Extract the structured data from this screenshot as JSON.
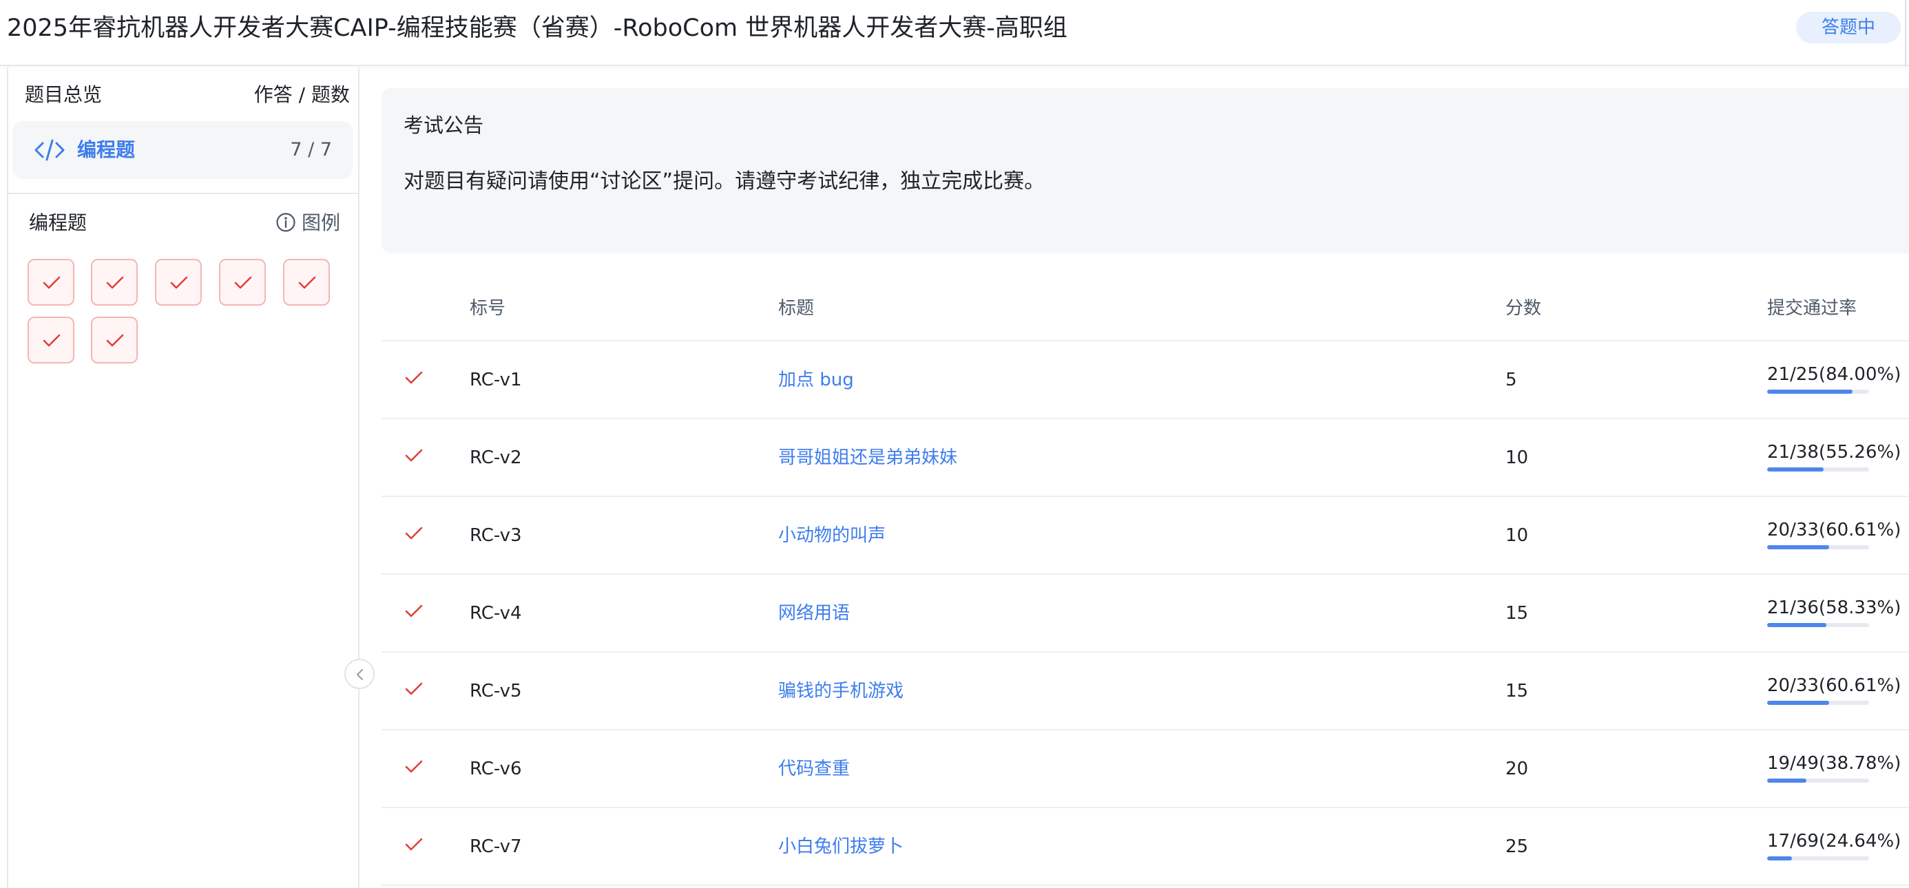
{
  "header": {
    "title": "2025年睿抗机器人开发者大赛CAIP-编程技能赛（省赛）-RoboCom 世界机器人开发者大赛-高职组",
    "status": "答题中"
  },
  "sidebar": {
    "overview_label": "题目总览",
    "answer_count_label": "作答 / 题数",
    "section": {
      "label": "编程题",
      "count": "7 / 7",
      "icon": "code-icon"
    },
    "sub_label": "编程题",
    "legend_label": "图例",
    "legend_icon": "info-icon",
    "questions": [
      {
        "status": "answered"
      },
      {
        "status": "answered"
      },
      {
        "status": "answered"
      },
      {
        "status": "answered"
      },
      {
        "status": "answered"
      },
      {
        "status": "answered"
      },
      {
        "status": "answered"
      }
    ]
  },
  "notice": {
    "title": "考试公告",
    "body": "对题目有疑问请使用“讨论区”提问。请遵守考试纪律，独立完成比赛。"
  },
  "table": {
    "headers": {
      "id": "标号",
      "title": "标题",
      "score": "分数",
      "rate": "提交通过率"
    },
    "rows": [
      {
        "id": "RC-v1",
        "title": "加点 bug",
        "score": "5",
        "rate": "21/25(84.00%)",
        "rate_value": 0.84
      },
      {
        "id": "RC-v2",
        "title": "哥哥姐姐还是弟弟妹妹",
        "score": "10",
        "rate": "21/38(55.26%)",
        "rate_value": 0.5526
      },
      {
        "id": "RC-v3",
        "title": "小动物的叫声",
        "score": "10",
        "rate": "20/33(60.61%)",
        "rate_value": 0.6061
      },
      {
        "id": "RC-v4",
        "title": "网络用语",
        "score": "15",
        "rate": "21/36(58.33%)",
        "rate_value": 0.5833
      },
      {
        "id": "RC-v5",
        "title": "骗钱的手机游戏",
        "score": "15",
        "rate": "20/33(60.61%)",
        "rate_value": 0.6061
      },
      {
        "id": "RC-v6",
        "title": "代码查重",
        "score": "20",
        "rate": "19/49(38.78%)",
        "rate_value": 0.3878
      },
      {
        "id": "RC-v7",
        "title": "小白兔们拔萝卜",
        "score": "25",
        "rate": "17/69(24.64%)",
        "rate_value": 0.2464
      }
    ]
  },
  "colors": {
    "accent": "#3d7ded",
    "check": "#e0403a",
    "bar": "#4f86ec"
  }
}
